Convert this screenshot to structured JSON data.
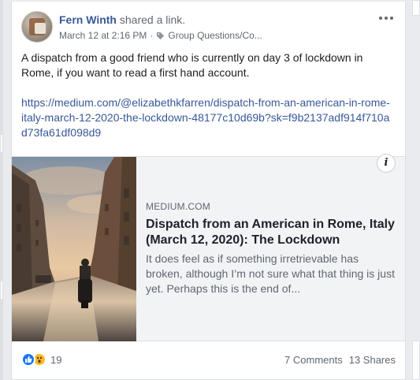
{
  "post": {
    "author": "Fern Winth",
    "action": "shared a link.",
    "timestamp": "March 12 at 2:16 PM",
    "separator": "·",
    "audience": "Group Questions/Co...",
    "text": "A dispatch from a good friend who is currently on day 3 of lockdown in Rome, if you want to read a first hand account.",
    "link_url": "https://medium.com/@elizabethkfarren/dispatch-from-an-american-in-rome-italy-march-12-2020-the-lockdown-48177c10d69b?sk=f9b2137adf914f710ad73fa61df098d9"
  },
  "preview": {
    "domain": "MEDIUM.COM",
    "title": "Dispatch from an American in Rome, Italy (March 12, 2020): The Lockdown",
    "description": "It does feel as if something irretrievable has broken, although I’m not sure what that thing is just yet. Perhaps this is the end of...",
    "info_glyph": "i"
  },
  "footer": {
    "reaction_count": "19",
    "comments": "7 Comments",
    "shares": "13 Shares"
  },
  "icons": {
    "more": "more-options-icon",
    "tag": "tag-icon",
    "like": "like-reaction-icon",
    "wow": "wow-reaction-icon",
    "info": "info-icon"
  },
  "colors": {
    "link": "#385898",
    "like": "#1877f2",
    "wow": "#f7b928",
    "background": "#e9ebee"
  }
}
